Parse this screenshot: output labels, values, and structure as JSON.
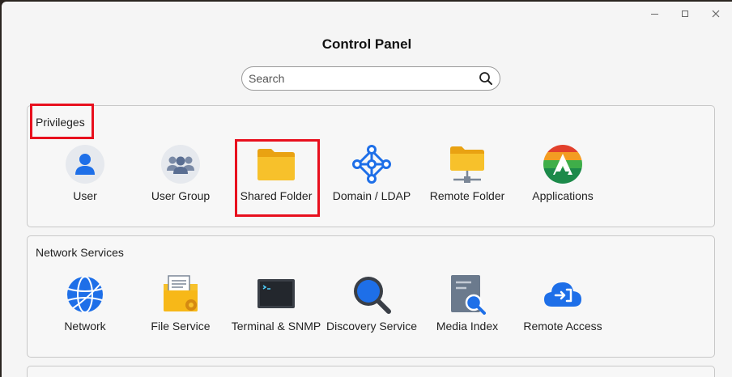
{
  "window": {
    "title": "Control Panel"
  },
  "search": {
    "placeholder": "Search"
  },
  "sections": [
    {
      "title": "Privileges",
      "items": [
        {
          "label": "User",
          "icon": "user-icon"
        },
        {
          "label": "User Group",
          "icon": "user-group-icon"
        },
        {
          "label": "Shared Folder",
          "icon": "folder-icon"
        },
        {
          "label": "Domain / LDAP",
          "icon": "domain-network-icon"
        },
        {
          "label": "Remote Folder",
          "icon": "remote-folder-icon"
        },
        {
          "label": "Applications",
          "icon": "applications-icon"
        }
      ]
    },
    {
      "title": "Network Services",
      "items": [
        {
          "label": "Network",
          "icon": "globe-icon"
        },
        {
          "label": "File Service",
          "icon": "file-service-icon"
        },
        {
          "label": "Terminal & SNMP",
          "icon": "terminal-icon"
        },
        {
          "label": "Discovery Service",
          "icon": "magnifier-icon"
        },
        {
          "label": "Media Index",
          "icon": "media-index-icon"
        },
        {
          "label": "Remote Access",
          "icon": "cloud-login-icon"
        }
      ]
    }
  ],
  "colors": {
    "highlight": "#e8101e",
    "accent_blue": "#1e6fe8",
    "folder_yellow": "#f7b818"
  }
}
